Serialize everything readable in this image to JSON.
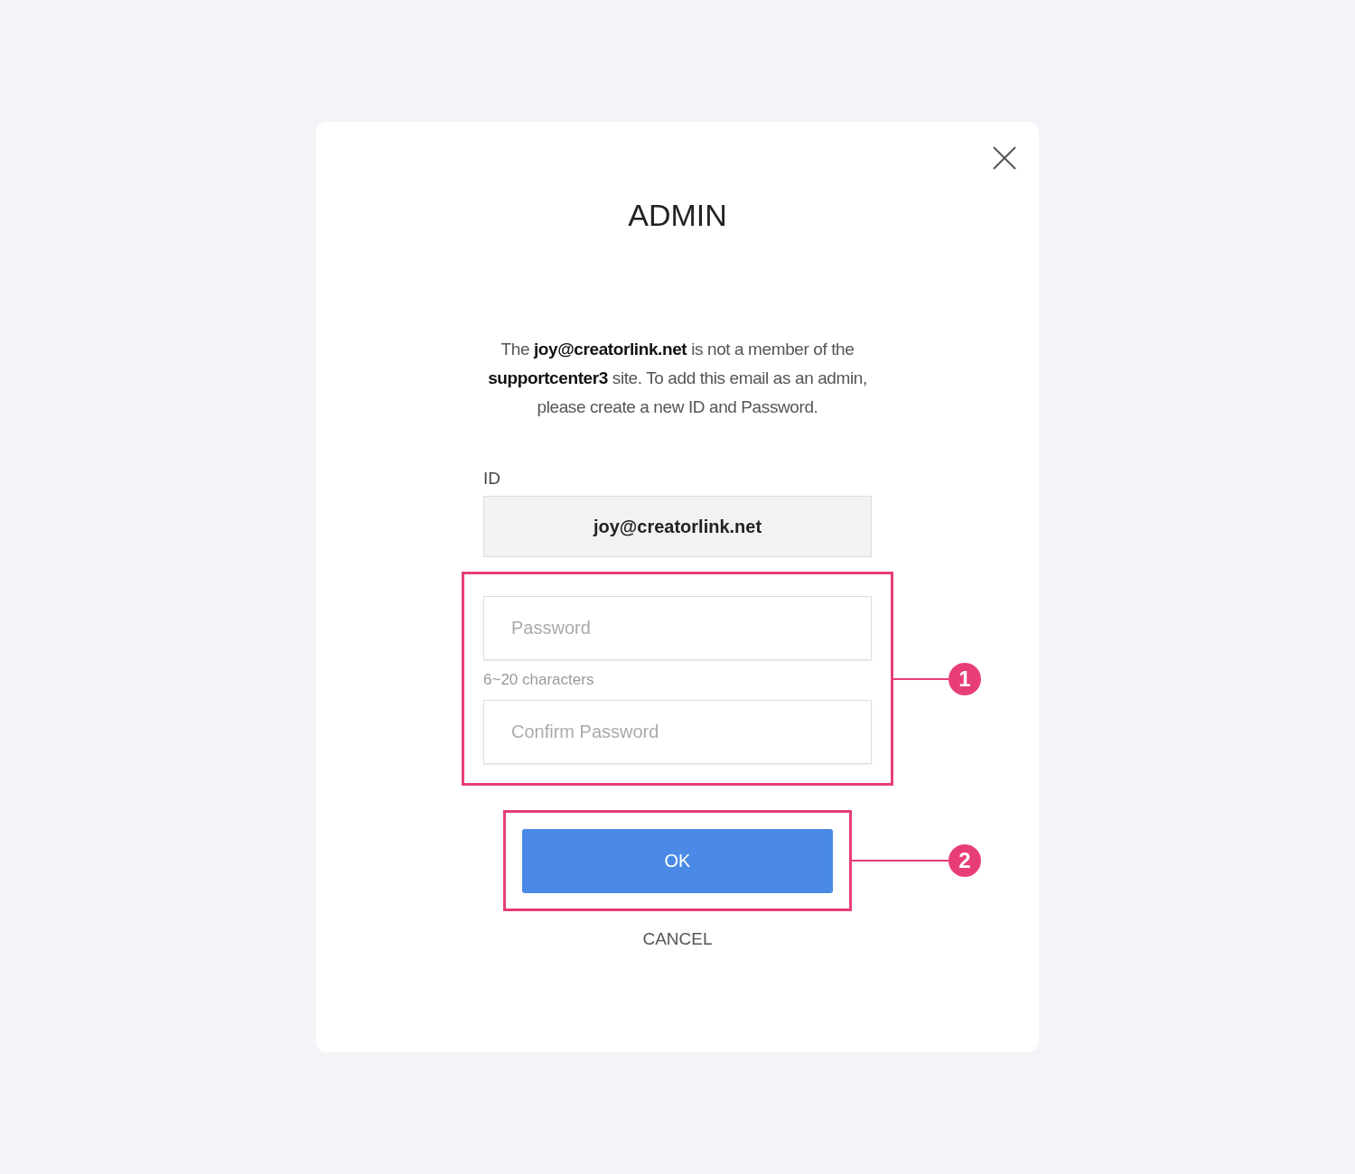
{
  "dialog": {
    "title": "ADMIN",
    "message": "The **joy@creatorlink.net** is not a member of the **supportcenter3** site. To add this email as an admin, please create a new ID and Password.",
    "id_label": "ID",
    "id_value": "joy@creatorlink.net",
    "password": {
      "placeholder": "Password"
    },
    "password_hint": "6~20 characters",
    "confirm_password": {
      "placeholder": "Confirm Password"
    },
    "ok_button": "OK",
    "cancel_link": "CANCEL"
  },
  "annotations": [
    {
      "number": "1"
    },
    {
      "number": "2"
    }
  ]
}
